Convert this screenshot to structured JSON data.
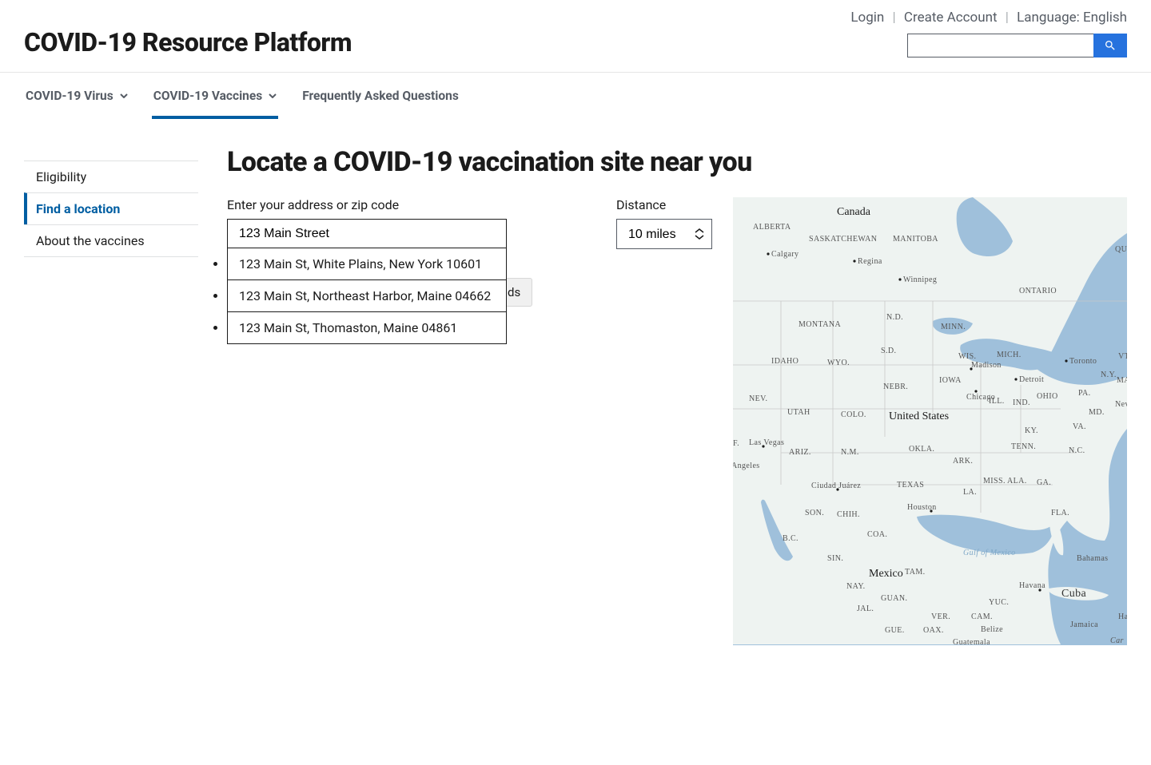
{
  "header": {
    "site_title": "COVID-19 Resource Platform",
    "top_links": {
      "login": "Login",
      "create_account": "Create Account",
      "language": "Language: English"
    }
  },
  "main_nav": [
    {
      "label": "COVID-19 Virus",
      "has_submenu": true,
      "active": false
    },
    {
      "label": "COVID-19 Vaccines",
      "has_submenu": true,
      "active": true
    },
    {
      "label": "Frequently Asked Questions",
      "has_submenu": false,
      "active": false
    }
  ],
  "sidenav": [
    {
      "label": "Eligibility",
      "active": false
    },
    {
      "label": "Find a location",
      "active": true
    },
    {
      "label": "About the vaccines",
      "active": false
    }
  ],
  "page_heading": "Locate a COVID-19 vaccination site near you",
  "form": {
    "address_label": "Enter your address or zip code",
    "address_value": "123 Main Street",
    "distance_label": "Distance",
    "distance_value": "10 miles",
    "suggestions": [
      "123 Main St, White Plains, New York 10601",
      "123 Main St, Northeast Harbor, Maine 04662",
      "123 Main St, Thomaston, Maine 04861"
    ],
    "results_partial": "ds"
  },
  "map": {
    "countries": [
      "Canada",
      "United States",
      "Mexico"
    ],
    "provinces": [
      "ALBERTA",
      "SASKATCHEWAN",
      "MANITOBA",
      "ONTARIO",
      "QUI"
    ],
    "states_row1": [
      "MONTANA",
      "N.D.",
      "MINN."
    ],
    "states_row2": [
      "IDAHO",
      "WYO.",
      "S.D.",
      "WIS.",
      "MICH."
    ],
    "states_row3": [
      "NEV.",
      "UTAH",
      "COLO.",
      "NEBR.",
      "IOWA",
      "ILL.",
      "IND.",
      "OHIO"
    ],
    "states_row4a": [
      "PA.",
      "N.Y.",
      "VT",
      "MA"
    ],
    "states_row4": [
      "ARIZ.",
      "N.M.",
      "OKLA.",
      "ARK.",
      "TENN.",
      "N.C.",
      "KY.",
      "VA.",
      "MD.",
      "Nev"
    ],
    "states_row5": [
      "TEXAS",
      "LA.",
      "MISS.",
      "ALA.",
      "GA.",
      "FLA."
    ],
    "mexico": [
      "B.C.",
      "SON.",
      "CHIH.",
      "COA.",
      "SIN.",
      "TAM.",
      "NAY.",
      "GUAN.",
      "JAL.",
      "GUE.",
      "OAX.",
      "VER.",
      "YUC.",
      "CAM."
    ],
    "cities": [
      "Calgary",
      "Regina",
      "Winnipeg",
      "Las Vegas",
      "Angeles",
      "Madison",
      "Detroit",
      "Chicago",
      "Houston",
      "Ciudad Juárez",
      "Toronto"
    ],
    "carib": [
      "Bahamas",
      "Cuba",
      "Havana",
      "Jamaica",
      "Belize",
      "Guatemala",
      "Ha",
      "Car"
    ],
    "gulf": "Gulf of Mexico",
    "f_label": "F."
  }
}
